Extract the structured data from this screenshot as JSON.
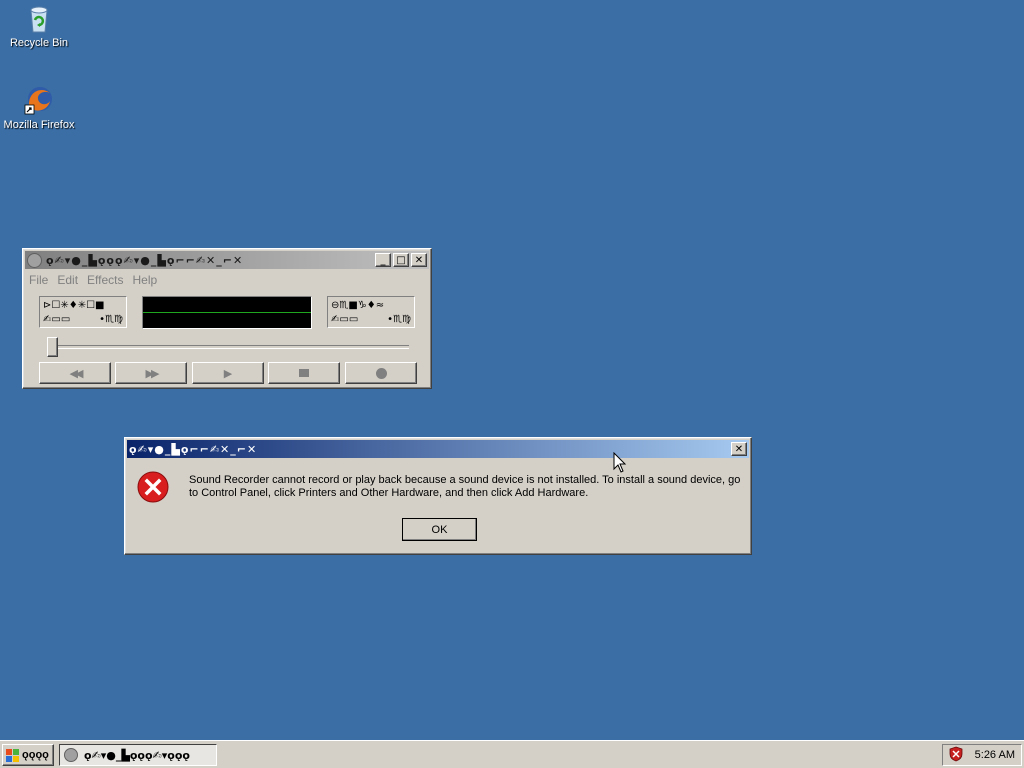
{
  "desktop": {
    "icons": [
      {
        "label": "Recycle Bin",
        "icon": "recycle-bin-icon"
      },
      {
        "label": "Mozilla Firefox",
        "icon": "firefox-icon"
      }
    ]
  },
  "recorder": {
    "title": "ǫ✍▾●_▙ǫǫǫ✍▾●_▙ǫ⌐⌐✍✕_⌐✕",
    "menu": [
      "File",
      "Edit",
      "Effects",
      "Help"
    ],
    "position_glyphs": [
      "⊳☐✳♦✳☐■",
      "✍▭▭"
    ],
    "length_glyphs": [
      "⊖♏■♑♦≈",
      "✍▭▭"
    ],
    "position_suffix": "•♏♍",
    "length_suffix": "•♏♍",
    "slider_position": 0,
    "buttons": [
      "seek-start",
      "seek-end",
      "play",
      "stop",
      "record"
    ]
  },
  "dialog": {
    "title": "ǫ✍▾●_▙ǫ⌐⌐✍✕_⌐✕",
    "message": "Sound Recorder cannot record or play back because a sound device is not installed. To install a sound device, go to Control Panel, click Printers and Other Hardware, and then click Add Hardware.",
    "ok_label": "OK"
  },
  "taskbar": {
    "start_label": "ǫǫǫǫ",
    "task_label": "ǫ✍▾●_▙ǫǫǫ✍▾ǫǫǫ",
    "clock": "5:26 AM"
  },
  "colors": {
    "desktop": "#3a6ea5",
    "error_red": "#d81e1e",
    "active_title": "#0a246a"
  }
}
